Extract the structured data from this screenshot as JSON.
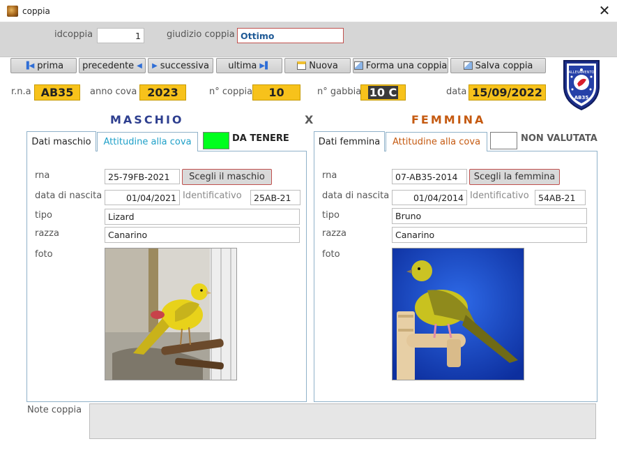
{
  "window": {
    "title": "coppia",
    "close_symbol": "✕"
  },
  "header": {
    "idcoppia_label": "idcoppia",
    "idcoppia_value": "1",
    "giudizio_label": "giudizio  coppia",
    "giudizio_value": "Ottimo"
  },
  "toolbar": {
    "prima": "prima",
    "precedente": "precedente",
    "successiva": "successiva",
    "ultima": "ultima",
    "nuova": "Nuova",
    "forma": "Forma una coppia",
    "salva": "Salva coppia"
  },
  "info": {
    "rna_label": "r.n.a",
    "rna_value": "AB35",
    "anno_label": "anno cova",
    "anno_value": "2023",
    "coppia_label": "n° coppia",
    "coppia_value": "10",
    "gabbia_label": "n° gabbia",
    "gabbia_value": "10 C",
    "data_label": "data",
    "data_value": "15/09/2022"
  },
  "logo": {
    "top_text": "ALLEVAMENTO",
    "bottom_text": "AB35"
  },
  "sections": {
    "male": "MASCHIO",
    "x": "X",
    "female": "FEMMINA"
  },
  "colors": {
    "male_heading": "#2e3f8f",
    "female_heading": "#c55a11",
    "status_green": "#00ff1e",
    "accent_yellow": "#f7c21b"
  },
  "male": {
    "tab_data": "Dati maschio",
    "tab_attitude": "Attitudine alla cova",
    "status": "DA TENERE",
    "rna_label": "rna",
    "rna_value": "25-79FB-2021",
    "choose_button": "Scegli il maschio",
    "birth_label": "data di nascita",
    "birth_value": "01/04/2021",
    "ident_label": "Identificativo",
    "ident_value": "25AB-21",
    "tipo_label": "tipo",
    "tipo_value": "Lizard",
    "razza_label": "razza",
    "razza_value": "Canarino",
    "foto_label": "foto"
  },
  "female": {
    "tab_data": "Dati femmina",
    "tab_attitude": "Attitudine alla cova",
    "status": "NON VALUTATA",
    "rna_label": "rna",
    "rna_value": "07-AB35-2014",
    "choose_button": "Scegli la femmina",
    "birth_label": "data di nascita",
    "birth_value": "01/04/2014",
    "ident_label": "Identificativo",
    "ident_value": "54AB-21",
    "tipo_label": "tipo",
    "tipo_value": "Bruno",
    "razza_label": "razza",
    "razza_value": "Canarino",
    "foto_label": "foto"
  },
  "notes": {
    "label": "Note coppia",
    "value": ""
  }
}
